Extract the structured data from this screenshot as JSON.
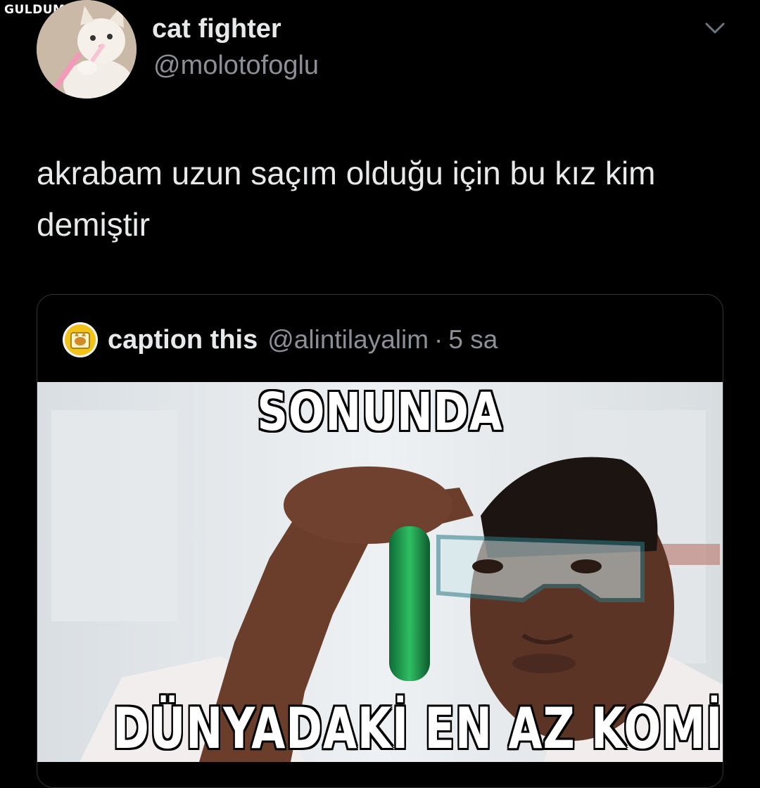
{
  "watermark": "GULDUM.NET",
  "tweet": {
    "display_name": "cat fighter",
    "handle": "@molotofoglu",
    "text": "akrabam uzun saçım olduğu için bu kız kim demiştir"
  },
  "quoted_tweet": {
    "display_name": "caption this",
    "handle": "@alintilayalim",
    "separator": "·",
    "time": "5 sa",
    "image": {
      "top_text": "SONUNDA",
      "bottom_text": "DÜNYADAKİ EN AZ KOMİK ŞEY"
    }
  },
  "icons": {
    "menu": "chevron-down-icon"
  },
  "colors": {
    "background": "#000000",
    "primary_text": "#e7e9ea",
    "secondary_text": "#8b9097",
    "card_border": "#2f3336"
  }
}
